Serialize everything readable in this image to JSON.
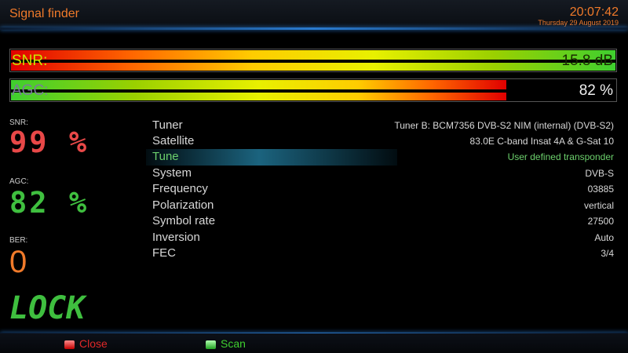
{
  "header": {
    "title": "Signal finder",
    "time": "20:07:42",
    "date": "Thursday 29 August 2019"
  },
  "bars": {
    "snr": {
      "label": "SNR:",
      "value": "15.8 dB",
      "level": 1.0
    },
    "agc": {
      "label": "AGC:",
      "value": "82 %",
      "level": 0.82
    }
  },
  "stats": {
    "snr_label": "SNR:",
    "snr_value": "99 %",
    "agc_label": "AGC:",
    "agc_value": "82 %",
    "ber_label": "BER:",
    "ber_value": "0",
    "lock": "LOCK"
  },
  "info": [
    {
      "key": "Tuner",
      "value": "Tuner B: BCM7356 DVB-S2 NIM (internal) (DVB-S2)"
    },
    {
      "key": "Satellite",
      "value": "83.0E C-band Insat 4A & G-Sat 10"
    },
    {
      "key": "Tune",
      "value": "User defined transponder"
    },
    {
      "key": "System",
      "value": "DVB-S"
    },
    {
      "key": "Frequency",
      "value": "03885"
    },
    {
      "key": "Polarization",
      "value": "vertical"
    },
    {
      "key": "Symbol rate",
      "value": "27500"
    },
    {
      "key": "Inversion",
      "value": "Auto"
    },
    {
      "key": "FEC",
      "value": "3/4"
    }
  ],
  "footer": {
    "close_label": "Close",
    "scan_label": "Scan"
  },
  "colors": {
    "accent": "#f07a2a",
    "snr_value": "#e84848",
    "agc_value": "#3fbf3f",
    "ber_value": "#f07a2a",
    "selected": "#6cd06c"
  },
  "icons": [
    "red-key-icon",
    "green-key-icon"
  ]
}
